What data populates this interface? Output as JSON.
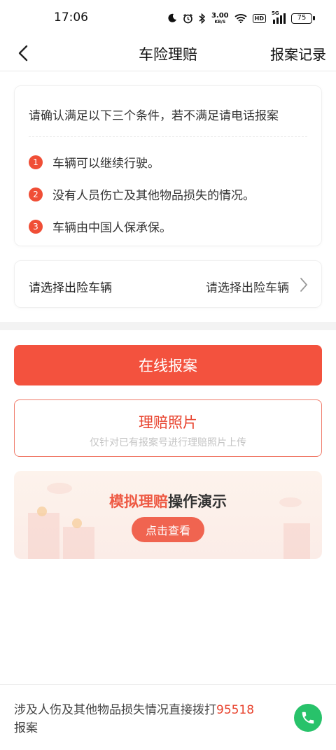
{
  "status_bar": {
    "time": "17:06",
    "net_speed_value": "3.00",
    "net_speed_unit": "KB/S",
    "hd": "HD",
    "signal_label": "5G",
    "battery": "75"
  },
  "nav": {
    "title": "车险理赔",
    "right_link": "报案记录"
  },
  "conditions": {
    "heading": "请确认满足以下三个条件，若不满足请电话报案",
    "items": [
      {
        "num": "1",
        "text": "车辆可以继续行驶。"
      },
      {
        "num": "2",
        "text": "没有人员伤亡及其他物品损失的情况。"
      },
      {
        "num": "3",
        "text": "车辆由中国人保承保。"
      }
    ]
  },
  "vehicle": {
    "label": "请选择出险车辆",
    "placeholder": "请选择出险车辆"
  },
  "actions": {
    "online_report": "在线报案",
    "claim_photos_title": "理赔照片",
    "claim_photos_sub": "仅针对已有报案号进行理赔照片上传"
  },
  "demo": {
    "title_highlight": "模拟理赔",
    "title_rest": "操作演示",
    "button": "点击查看"
  },
  "footer": {
    "text_before": "涉及人伤及其他物品损失情况直接拨打",
    "phone": "95518",
    "text_after": "报案"
  },
  "colors": {
    "accent": "#f3523e",
    "call_green": "#28c26a"
  },
  "icons": [
    "back-arrow-icon",
    "chevron-right-icon",
    "phone-icon",
    "moon-icon",
    "alarm-icon",
    "bluetooth-icon",
    "wifi-icon",
    "signal-icon",
    "battery-icon"
  ]
}
